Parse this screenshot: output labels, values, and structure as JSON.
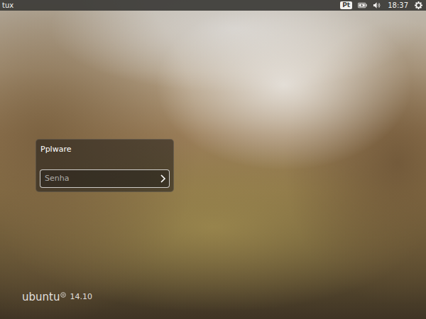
{
  "top_bar": {
    "host": "tux",
    "keyboard": "Pt",
    "time": "18:37"
  },
  "login": {
    "user": "Pplware",
    "password": {
      "placeholder": "Senha"
    }
  },
  "branding": {
    "name": "ubuntu",
    "version": "14.10"
  }
}
